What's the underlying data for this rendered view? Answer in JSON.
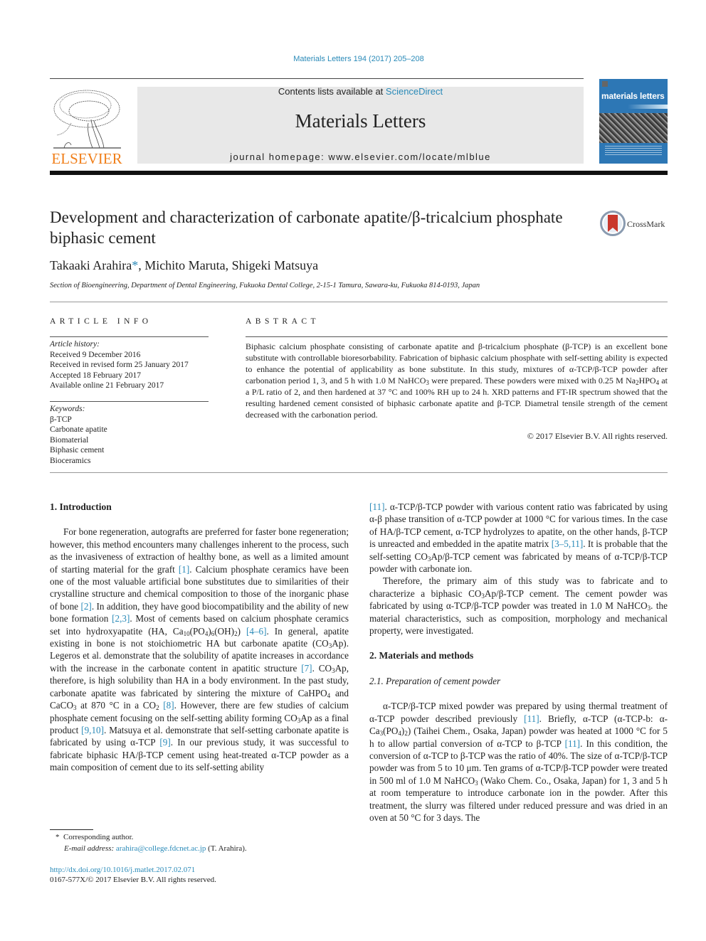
{
  "header": {
    "journal_ref": "Materials Letters 194 (2017) 205–208",
    "contents_prefix": "Contents lists available at ",
    "contents_link": "ScienceDirect",
    "journal_title": "Materials Letters",
    "homepage": "journal homepage: www.elsevier.com/locate/mlblue",
    "publisher_logo": "ELSEVIER",
    "cover_title": "materials letters",
    "colors": {
      "link": "#2a8ab8",
      "elsevier_orange": "#f07f1a",
      "cover_blue": "#2d77b5"
    }
  },
  "article": {
    "title": "Development and characterization of carbonate apatite/β-tricalcium phosphate biphasic cement",
    "crossmark_label": "CrossMark",
    "authors": [
      {
        "name": "Takaaki Arahira",
        "mark": "*"
      },
      {
        "name": "Michito Maruta",
        "mark": ""
      },
      {
        "name": "Shigeki Matsuya",
        "mark": ""
      }
    ],
    "affiliation": "Section of Bioengineering, Department of Dental Engineering, Fukuoka Dental College, 2-15-1 Tamura, Sawara-ku, Fukuoka 814-0193, Japan"
  },
  "article_info": {
    "heading": "ARTICLE INFO",
    "history_label": "Article history:",
    "history": [
      "Received 9 December 2016",
      "Received in revised form 25 January 2017",
      "Accepted 18 February 2017",
      "Available online 21 February 2017"
    ],
    "keywords_label": "Keywords:",
    "keywords": [
      "β-TCP",
      "Carbonate apatite",
      "Biomaterial",
      "Biphasic cement",
      "Bioceramics"
    ]
  },
  "abstract": {
    "heading": "ABSTRACT",
    "text_1": "Biphasic calcium phosphate consisting of carbonate apatite and β-tricalcium phosphate (β-TCP) is an excellent bone substitute with controllable bioresorbability. Fabrication of biphasic calcium phosphate with self-setting ability is expected to enhance the potential of applicability as bone substitute. In this study, mixtures of α-TCP/β-TCP powder after carbonation period 1, 3, and 5 h with 1.0 M NaHCO",
    "text_2": " were prepared. These powders were mixed with 0.25 M Na",
    "text_3": "HPO",
    "text_4": " at a P/L ratio of 2, and then hardened at 37 °C and 100% RH up to 24 h. XRD patterns and FT-IR spectrum showed that the resulting hardened cement consisted of biphasic carbonate apatite and β-TCP. Diametral tensile strength of the cement decreased with the carbonation period.",
    "copyright": "© 2017 Elsevier B.V. All rights reserved."
  },
  "sections": {
    "intro_heading": "1. Introduction",
    "intro": {
      "a": "For bone regeneration, autografts are preferred for faster bone regeneration; however, this method encounters many challenges inherent to the process, such as the invasiveness of extraction of healthy bone, as well as a limited amount of starting material for the graft ",
      "r1": "[1]",
      "b": ". Calcium phosphate ceramics have been one of the most valuable artificial bone substitutes due to similarities of their crystalline structure and chemical composition to those of the inorganic phase of bone ",
      "r2": "[2]",
      "c": ". In addition, they have good biocompatibility and the ability of new bone formation ",
      "r3": "[2,3]",
      "d": ". Most of cements based on calcium phosphate ceramics set into hydroxyapatite (HA, Ca",
      "d_sub1": "10",
      "d2": "(PO",
      "d_sub2": "4",
      "d3": ")",
      "d_sub3": "6",
      "d4": "(OH)",
      "d_sub4": "2",
      "d5": ") ",
      "r4": "[4–6]",
      "e": ". In general, apatite existing in bone is not stoichiometric HA but carbonate apatite (CO",
      "e_sub": "3",
      "e2": "Ap). Legeros et al. demonstrate that the solubility of apatite increases in accordance with the increase in the carbonate content in apatitic structure ",
      "r5": "[7]",
      "f": ". CO",
      "f_sub": "3",
      "f2": "Ap, therefore, is high solubility than HA in a body environment. In the past study, carbonate apatite was fabricated by sintering the mixture of CaHPO",
      "f_sub2": "4",
      "f3": " and CaCO",
      "f_sub3": "3",
      "f4": " at 870 °C in a CO",
      "f_sub4": "2",
      "f5": " ",
      "r6": "[8]",
      "g": ". However, there are few studies of calcium phosphate cement focusing on the self-setting ability forming CO",
      "g_sub": "3",
      "g2": "Ap as a final product ",
      "r7": "[9,10]",
      "h": ". Matsuya et al. demonstrate that self-setting carbonate apatite is fabricated by using α-TCP ",
      "r8": "[9]",
      "i": ". In our previous study, it was successful to fabricate biphasic HA/β-TCP cement using heat-treated α-TCP powder as a main composition of cement due to its self-setting ability ",
      "r9": "[11]",
      "j": ". α-TCP/β-TCP powder with various content ratio was fabricated by using α-β phase transition of α-TCP powder at 1000 °C for various times. In the case of HA/β-TCP cement, α-TCP hydrolyzes to apatite, on the other hands, β-TCP is unreacted and embedded in the apatite matrix ",
      "r10": "[3–5,11]",
      "k": ". It is probable that the self-setting CO",
      "k_sub": "3",
      "k2": "Ap/β-TCP cement was fabricated by means of α-TCP/β-TCP powder with carbonate ion."
    },
    "intro_p2": {
      "a": "Therefore, the primary aim of this study was to fabricate and to characterize a biphasic CO",
      "a_sub": "3",
      "b": "Ap/β-TCP cement. The cement powder was fabricated by using α-TCP/β-TCP powder was treated in 1.0 M NaHCO",
      "b_sub": "3",
      "c": ". the material characteristics, such as composition, morphology and mechanical property, were investigated."
    },
    "methods_heading": "2. Materials and methods",
    "sub_heading": "2.1. Preparation of cement powder",
    "methods": {
      "a": "α-TCP/β-TCP mixed powder was prepared by using thermal treatment of α-TCP powder described previously ",
      "r1": "[11]",
      "b": ". Briefly, α-TCP (α-TCP-b: α-Ca",
      "b_sub1": "3",
      "b2": "(PO",
      "b_sub2": "4",
      "b3": ")",
      "b_sub3": "2",
      "b4": ") (Taihei Chem., Osaka, Japan) powder was heated at 1000 °C for 5 h to allow partial conversion of α-TCP to β-TCP ",
      "r2": "[11]",
      "c": ". In this condition, the conversion of α-TCP to β-TCP was the ratio of 40%. The size of α-TCP/β-TCP powder was from 5 to 10 μm. Ten grams of α-TCP/β-TCP powder were treated in 500 ml of 1.0 M NaHCO",
      "c_sub": "3",
      "c2": " (Wako Chem. Co., Osaka, Japan) for 1, 3 and 5 h at room temperature to introduce carbonate ion in the powder. After this treatment, the slurry was filtered under reduced pressure and was dried in an oven at 50 °C for 3 days. The"
    }
  },
  "footnote": {
    "mark": "*",
    "corresponding": "Corresponding author.",
    "email_label": "E-mail address: ",
    "email": "arahira@college.fdcnet.ac.jp",
    "email_suffix": " (T. Arahira).",
    "doi": "http://dx.doi.org/10.1016/j.matlet.2017.02.071",
    "issn": "0167-577X/© 2017 Elsevier B.V. All rights reserved."
  }
}
